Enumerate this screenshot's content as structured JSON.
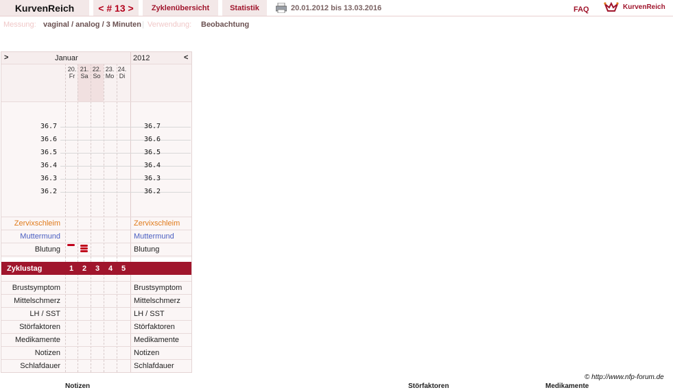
{
  "header": {
    "brand": "KurvenReich",
    "cycle_nav": "< # 13 >",
    "tab_overview": "Zyklenübersicht",
    "tab_stats": "Statistik",
    "date_range": "20.01.2012 bis 13.03.2016",
    "faq": "FAQ",
    "logo_text": "KurvenReich"
  },
  "meta": {
    "measure_label": "Messung:",
    "measure_value": "vaginal / analog / 3 Minuten",
    "separator": "|",
    "usage_label": "Verwendung:",
    "usage_value": "Beobachtung"
  },
  "chart": {
    "prev": ">",
    "next": "<",
    "month": "Januar",
    "year": "2012",
    "days": [
      {
        "date": "20.",
        "weekday": "Fr"
      },
      {
        "date": "21.",
        "weekday": "Sa"
      },
      {
        "date": "22.",
        "weekday": "So"
      },
      {
        "date": "23.",
        "weekday": "Mo"
      },
      {
        "date": "24.",
        "weekday": "Di"
      }
    ],
    "temps": [
      "36.7",
      "36.6",
      "36.5",
      "36.4",
      "36.3",
      "36.2"
    ],
    "rows_top": [
      "Zervixschleim",
      "Muttermund",
      "Blutung"
    ],
    "zyklustag_label": "Zyklustag",
    "cycle_days": [
      "1",
      "2",
      "3",
      "4",
      "5"
    ],
    "rows_bottom": [
      "Brustsymptom",
      "Mittelschmerz",
      "LH / SST",
      "Störfaktoren",
      "Medikamente",
      "Notizen",
      "Schlafdauer"
    ]
  },
  "colors": {
    "accent": "#a0152c",
    "zervix": "#e07a1a",
    "muttermund": "#4a5fc1"
  },
  "footer": {
    "copyright": "© http://www.nfp-forum.de",
    "heading_notes": "Notizen",
    "heading_stoer": "Störfaktoren",
    "heading_medi": "Medikamente"
  }
}
